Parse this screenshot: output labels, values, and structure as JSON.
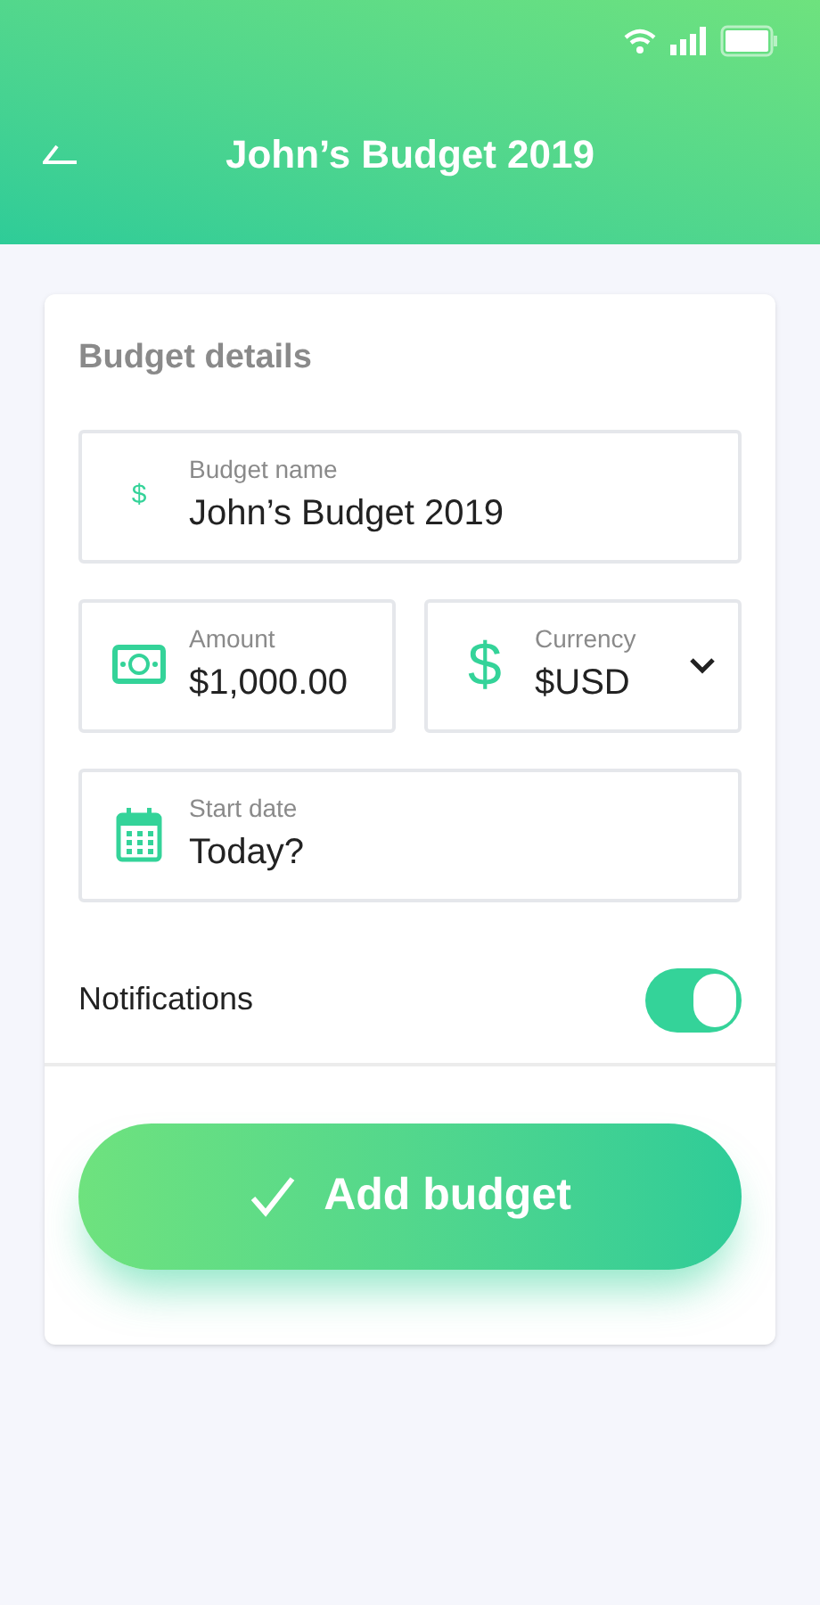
{
  "header": {
    "title": "John’s Budget 2019"
  },
  "card": {
    "heading": "Budget details",
    "fields": [
      {
        "kind": "name",
        "icon": "$",
        "label": "Budget name",
        "value": "John’s Budget 2019"
      },
      {
        "kind": "amount",
        "label": "Amount",
        "value": "$1,000.00"
      },
      {
        "kind": "currency",
        "icon": "$",
        "label": "Currency",
        "value": "$USD"
      },
      {
        "kind": "date",
        "label": "Start date",
        "value": "Today?"
      }
    ],
    "notifications": {
      "label": "Notifications",
      "on": true
    },
    "button": {
      "label": "Add budget"
    }
  }
}
